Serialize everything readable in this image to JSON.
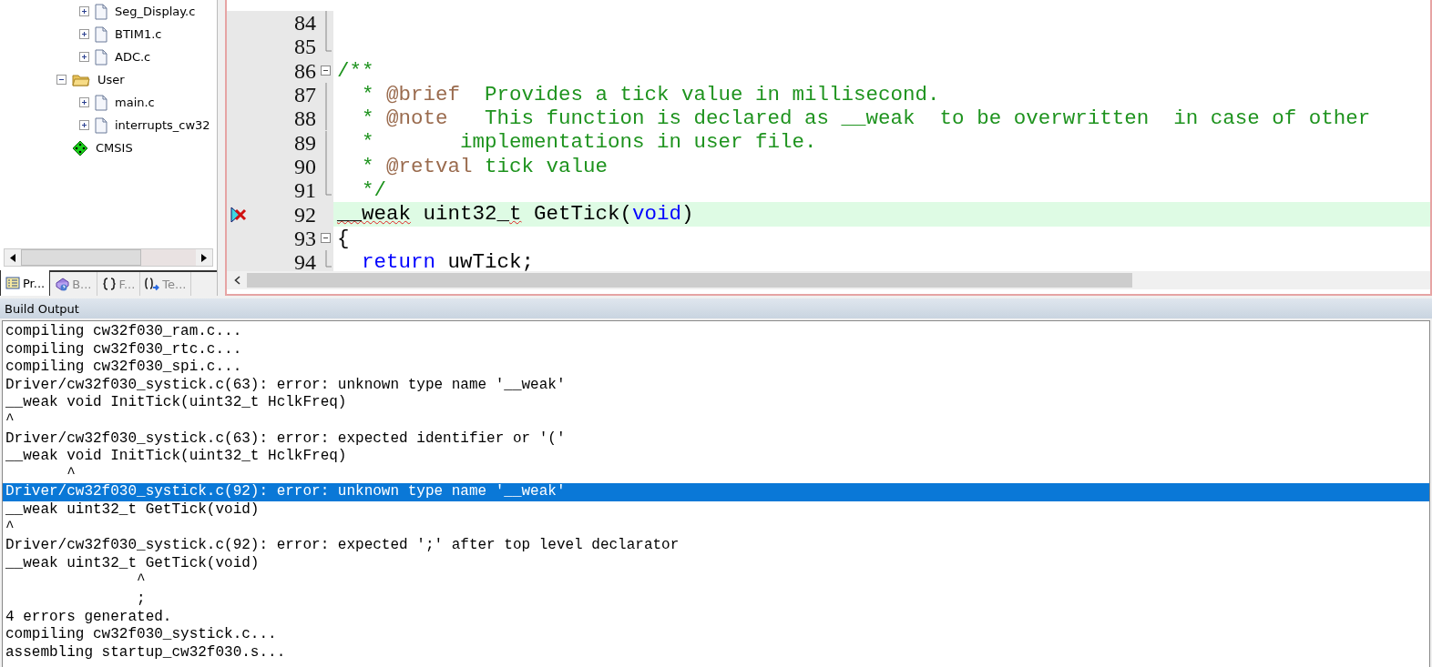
{
  "project_tree": {
    "items": [
      {
        "children": [
          {
            "label": "Seg_Display.c",
            "kind": "file",
            "expanded": false
          },
          {
            "label": "BTIM1.c",
            "kind": "file",
            "expanded": false
          },
          {
            "label": "ADC.c",
            "kind": "file",
            "expanded": false
          }
        ]
      },
      {
        "label": "User",
        "kind": "folder",
        "expanded": true,
        "children": [
          {
            "label": "main.c",
            "kind": "file",
            "expanded": false
          },
          {
            "label": "interrupts_cw32",
            "kind": "file",
            "expanded": false
          }
        ]
      },
      {
        "label": "CMSIS",
        "kind": "component"
      }
    ]
  },
  "panel_tabs": [
    {
      "label": "Pr...",
      "kind": "project",
      "selected": true
    },
    {
      "label": "B...",
      "kind": "books",
      "selected": false
    },
    {
      "label": "F...",
      "kind": "functions",
      "selected": false
    },
    {
      "label": "Te...",
      "kind": "templates",
      "selected": false
    }
  ],
  "editor": {
    "lines": [
      {
        "number": "84",
        "fold_toggle": false
      },
      {
        "number": "85",
        "fold_toggle": false
      },
      {
        "number": "86",
        "fold_toggle": true,
        "segments": [
          {
            "kind": "comment",
            "text": "/**"
          }
        ]
      },
      {
        "number": "87",
        "fold_toggle": false,
        "segments": [
          {
            "kind": "comment",
            "text": "  * "
          },
          {
            "kind": "doc-tag",
            "text": "@brief"
          },
          {
            "kind": "comment",
            "text": "  Provides a tick value in millisecond."
          }
        ]
      },
      {
        "number": "88",
        "fold_toggle": false,
        "segments": [
          {
            "kind": "comment",
            "text": "  * "
          },
          {
            "kind": "doc-tag",
            "text": "@note"
          },
          {
            "kind": "comment",
            "text": "   This function is declared as __weak  to be overwritten  in case of other"
          }
        ]
      },
      {
        "number": "89",
        "fold_toggle": false,
        "segments": [
          {
            "kind": "comment",
            "text": "  *       implementations in user file."
          }
        ]
      },
      {
        "number": "90",
        "fold_toggle": false,
        "segments": [
          {
            "kind": "comment",
            "text": "  * "
          },
          {
            "kind": "doc-tag",
            "text": "@retval"
          },
          {
            "kind": "comment",
            "text": " tick value"
          }
        ]
      },
      {
        "number": "91",
        "fold_toggle": false,
        "segments": [
          {
            "kind": "comment",
            "text": "  */"
          }
        ]
      },
      {
        "number": "92",
        "fold_toggle": false,
        "highlighted": true,
        "error": true,
        "segments": [
          {
            "kind": "squiggle",
            "text": "__weak"
          },
          {
            "kind": "plain",
            "text": " uint32_"
          },
          {
            "kind": "squiggle",
            "text": "t"
          },
          {
            "kind": "plain",
            "text": " GetTick("
          },
          {
            "kind": "keyword",
            "text": "void"
          },
          {
            "kind": "plain",
            "text": ")"
          }
        ]
      },
      {
        "number": "93",
        "fold_toggle": true,
        "segments": [
          {
            "kind": "plain",
            "text": "{"
          }
        ]
      },
      {
        "number": "94",
        "fold_toggle": false,
        "segments": [
          {
            "kind": "keyword",
            "text": "  return"
          },
          {
            "kind": "plain",
            "text": " uwTick;"
          }
        ]
      }
    ]
  },
  "build_output": {
    "title": "Build Output",
    "lines": [
      {
        "text": "compiling cw32f030_ram.c...",
        "selected": false
      },
      {
        "text": "compiling cw32f030_rtc.c...",
        "selected": false
      },
      {
        "text": "compiling cw32f030_spi.c...",
        "selected": false
      },
      {
        "text": "Driver/cw32f030_systick.c(63): error: unknown type name '__weak'",
        "selected": false
      },
      {
        "text": "__weak void InitTick(uint32_t HclkFreq)",
        "selected": false
      },
      {
        "text": "^",
        "selected": false
      },
      {
        "text": "Driver/cw32f030_systick.c(63): error: expected identifier or '('",
        "selected": false
      },
      {
        "text": "__weak void InitTick(uint32_t HclkFreq)",
        "selected": false
      },
      {
        "text": "       ^",
        "selected": false
      },
      {
        "text": "Driver/cw32f030_systick.c(92): error: unknown type name '__weak'",
        "selected": true
      },
      {
        "text": "__weak uint32_t GetTick(void)",
        "selected": false
      },
      {
        "text": "^",
        "selected": false
      },
      {
        "text": "Driver/cw32f030_systick.c(92): error: expected ';' after top level declarator",
        "selected": false
      },
      {
        "text": "__weak uint32_t GetTick(void)",
        "selected": false
      },
      {
        "text": "               ^",
        "selected": false
      },
      {
        "text": "               ;",
        "selected": false
      },
      {
        "text": "4 errors generated.",
        "selected": false
      },
      {
        "text": "compiling cw32f030_systick.c...",
        "selected": false
      },
      {
        "text": "assembling startup_cw32f030.s...",
        "selected": false
      }
    ]
  }
}
